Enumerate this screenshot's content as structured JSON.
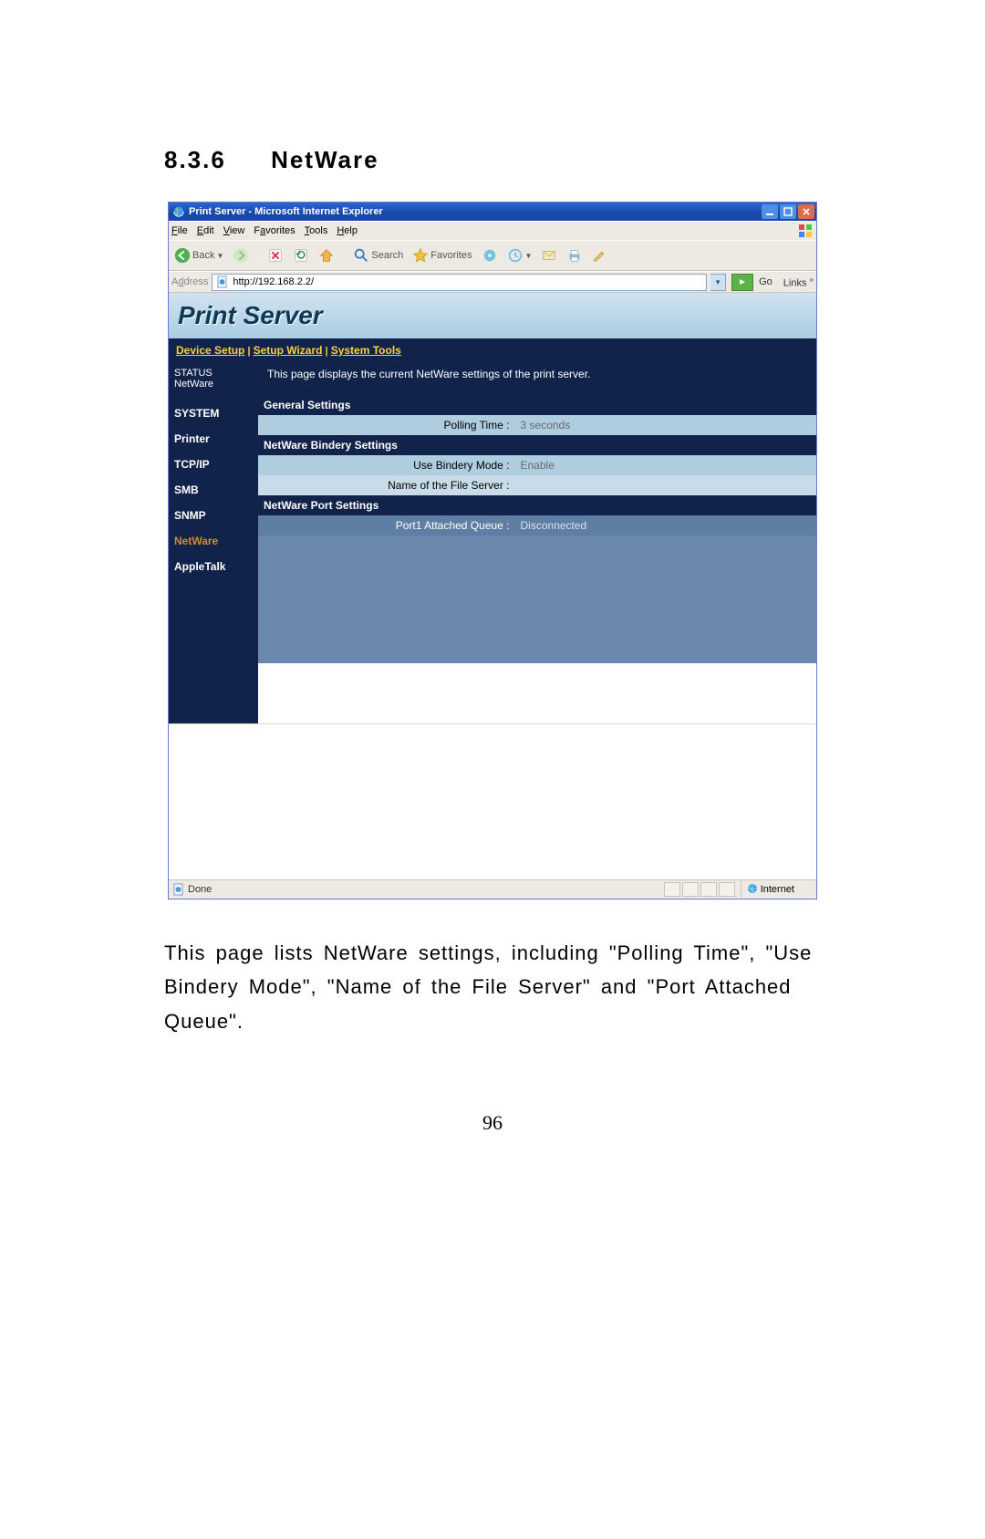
{
  "doc": {
    "section_number": "8.3.6",
    "section_title": "NetWare",
    "caption": "This page lists NetWare settings, including \"Polling Time\", \"Use Bindery Mode\", \"Name of the File Server\" and \"Port Attached Queue\".",
    "page_number": "96"
  },
  "browser": {
    "app_title": "Print Server - Microsoft Internet Explorer",
    "menus": {
      "file": "File",
      "edit": "Edit",
      "view": "View",
      "favorites": "Favorites",
      "tools": "Tools",
      "help": "Help"
    },
    "toolbar": {
      "back": "Back",
      "search": "Search",
      "favorites": "Favorites"
    },
    "address_label": "Address",
    "address_value": "http://192.168.2.2/",
    "go_label": "Go",
    "links_label": "Links",
    "status_text": "Done",
    "zone_text": "Internet"
  },
  "app": {
    "brand_title": "Print Server",
    "nav": {
      "device_setup": "Device Setup",
      "setup_wizard": "Setup Wizard",
      "system_tools": "System Tools"
    },
    "description": "This page displays the current NetWare settings of the print server.",
    "sidebar": {
      "status_heading": "STATUS",
      "status_sub": "NetWare",
      "items": [
        {
          "label": "SYSTEM"
        },
        {
          "label": "Printer"
        },
        {
          "label": "TCP/IP"
        },
        {
          "label": "SMB"
        },
        {
          "label": "SNMP"
        },
        {
          "label": "NetWare"
        },
        {
          "label": "AppleTalk"
        }
      ]
    },
    "sections": {
      "general_title": "General Settings",
      "polling_label": "Polling Time :",
      "polling_value": "3 seconds",
      "bindery_title": "NetWare Bindery Settings",
      "bindery_mode_label": "Use Bindery Mode :",
      "bindery_mode_value": "Enable",
      "fileserver_label": "Name of the File Server :",
      "fileserver_value": "",
      "port_title": "NetWare Port Settings",
      "port_queue_label": "Port1 Attached Queue :",
      "port_queue_value": "Disconnected"
    }
  }
}
